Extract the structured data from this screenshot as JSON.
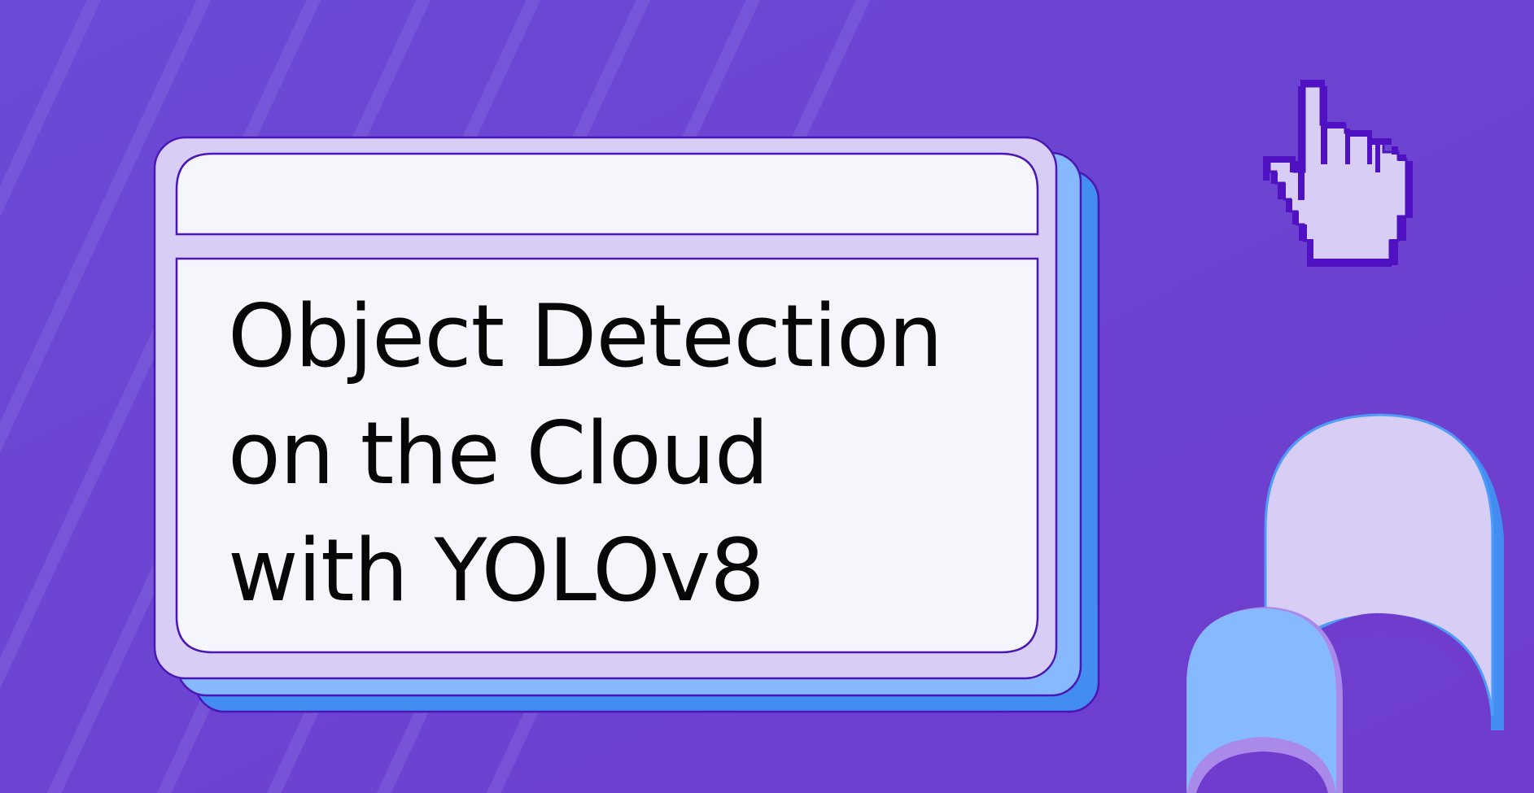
{
  "title": {
    "lines": [
      "Object Detection",
      "on the Cloud",
      "with YOLOv8"
    ]
  },
  "icons": [
    "pointer-hand-icon",
    "arch-shape-icon"
  ],
  "colors": {
    "background": "#6a47d2",
    "panel_lavender": "#d8cef5",
    "panel_light_blue": "#86b9fd",
    "panel_blue": "#438df1",
    "window_body": "#f5f6fb",
    "outline": "#4b16b7",
    "text": "#070707"
  }
}
